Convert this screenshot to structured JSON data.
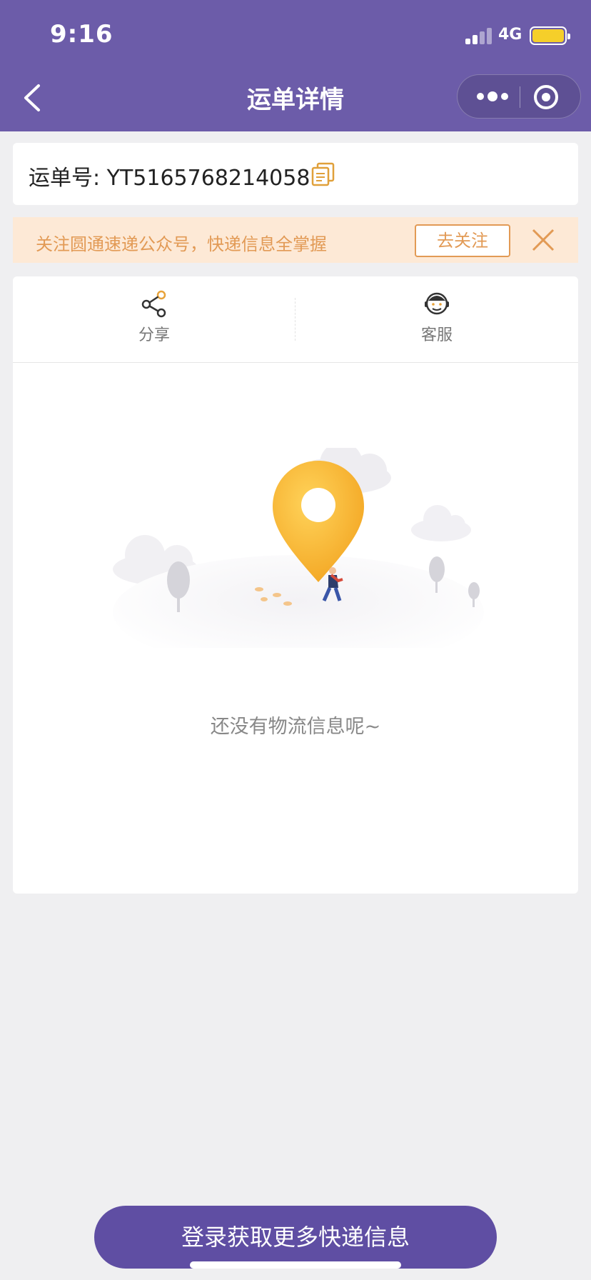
{
  "status_bar": {
    "time": "9:16",
    "network": "4G",
    "battery_color": "#f5cf2a"
  },
  "nav": {
    "title": "运单详情",
    "back_icon": "chevron-left-icon",
    "more_icon": "more-dots-icon",
    "close_icon": "target-circle-icon"
  },
  "waybill": {
    "label": "运单号: YT5165768214058",
    "copy_icon": "copy-icon"
  },
  "banner": {
    "text": "关注圆通速递公众号，快递信息全掌握",
    "follow_label": "去关注",
    "text_color": "#e29a55",
    "background": "#fde9d6"
  },
  "actions": [
    {
      "label": "分享",
      "icon": "share-icon"
    },
    {
      "label": "客服",
      "icon": "customer-service-icon"
    }
  ],
  "empty_state": {
    "message": "还没有物流信息呢~",
    "illustration": "location-pin-illustration"
  },
  "bottom": {
    "login_label": "登录获取更多快递信息"
  },
  "colors": {
    "header": "#6c5ca9",
    "button": "#5f4ea3",
    "accent_orange": "#e29a55",
    "pin_yellow": "#f7b52a"
  }
}
